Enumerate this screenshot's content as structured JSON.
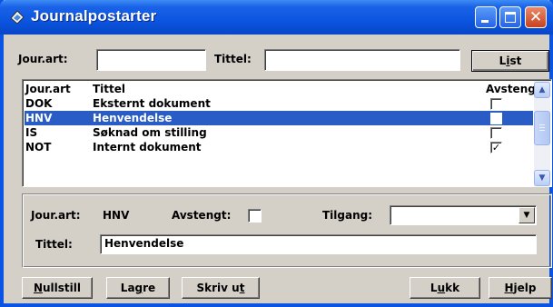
{
  "window": {
    "title": "Journalpostarter",
    "minimize_glyph": "",
    "maximize_glyph": "",
    "close_glyph": "✕"
  },
  "search": {
    "jourart_label": "Jour.art:",
    "jourart_value": "",
    "tittel_label": "Tittel:",
    "tittel_value": "",
    "list_button": {
      "mnemonic": "i",
      "pre": "L",
      "post": "st"
    }
  },
  "list": {
    "columns": [
      "Jour.art",
      "Tittel",
      "Avstengt"
    ],
    "rows": [
      {
        "code": "DOK",
        "title": "Eksternt dokument",
        "checked": false,
        "selected": false
      },
      {
        "code": "HNV",
        "title": "Henvendelse",
        "checked": false,
        "selected": true
      },
      {
        "code": "IS",
        "title": "Søknad om stilling",
        "checked": false,
        "selected": false
      },
      {
        "code": "NOT",
        "title": "Internt dokument",
        "checked": true,
        "selected": false
      }
    ],
    "scroll_up_glyph": "▲",
    "scroll_down_glyph": "▼"
  },
  "detail": {
    "jourart_label": "Jour.art:",
    "jourart_value": "HNV",
    "avstengt_label": "Avstengt:",
    "tilgang_label": "Tilgang:",
    "tilgang_value": "",
    "dropdown_glyph": "▼",
    "tittel_label": "Tittel:",
    "tittel_value": "Henvendelse"
  },
  "buttons": {
    "nullstill": {
      "pre": "",
      "mnemonic": "N",
      "post": "ullstill"
    },
    "lagre": {
      "pre": "La",
      "mnemonic": "g",
      "post": "re"
    },
    "skriv_ut": {
      "pre": "Skriv u",
      "mnemonic": "t",
      "post": ""
    },
    "lukk": {
      "pre": "L",
      "mnemonic": "u",
      "post": "kk"
    },
    "hjelp": {
      "pre": "",
      "mnemonic": "H",
      "post": "jelp"
    }
  },
  "colors": {
    "titlebar": "#0b55e0",
    "face": "#d4d0c8",
    "selection": "#2a5cc6"
  },
  "icons": [
    "app-icon",
    "minimize-icon",
    "maximize-icon",
    "close-icon",
    "scroll-up-icon",
    "scroll-down-icon",
    "dropdown-arrow-icon",
    "checkmark-icon"
  ]
}
